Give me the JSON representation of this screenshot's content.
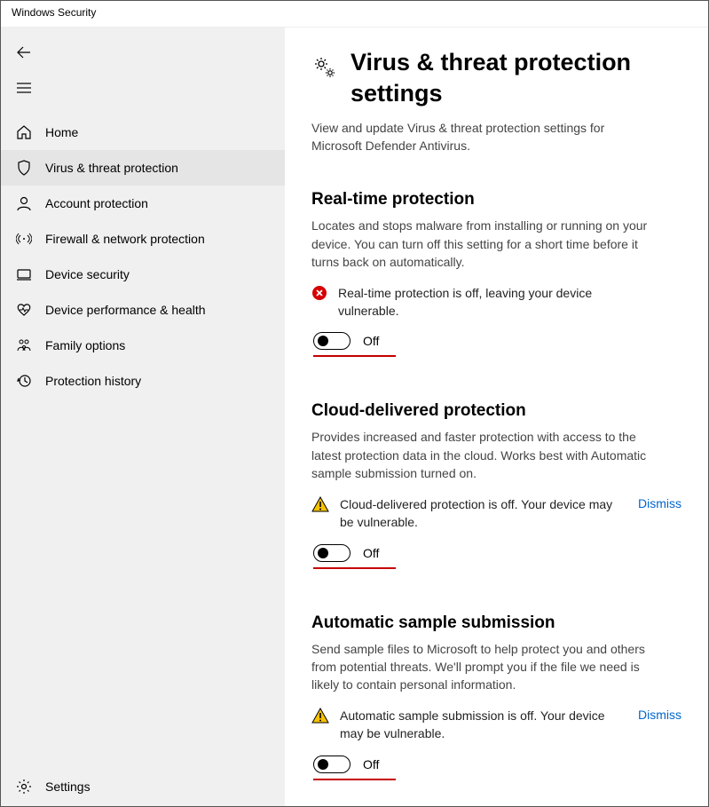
{
  "window": {
    "title": "Windows Security"
  },
  "sidebar": {
    "items": [
      {
        "label": "Home"
      },
      {
        "label": "Virus & threat protection"
      },
      {
        "label": "Account protection"
      },
      {
        "label": "Firewall & network protection"
      },
      {
        "label": "Device security"
      },
      {
        "label": "Device performance & health"
      },
      {
        "label": "Family options"
      },
      {
        "label": "Protection history"
      }
    ],
    "settings_label": "Settings"
  },
  "page": {
    "title": "Virus & threat protection settings",
    "subtitle": "View and update Virus & threat protection settings for Microsoft Defender Antivirus."
  },
  "sections": {
    "realtime": {
      "title": "Real-time protection",
      "desc": "Locates and stops malware from installing or running on your device. You can turn off this setting for a short time before it turns back on automatically.",
      "alert": "Real-time protection is off, leaving your device vulnerable.",
      "toggle_state": "Off"
    },
    "cloud": {
      "title": "Cloud-delivered protection",
      "desc": "Provides increased and faster protection with access to the latest protection data in the cloud. Works best with Automatic sample submission turned on.",
      "alert": "Cloud-delivered protection is off. Your device may be vulnerable.",
      "dismiss": "Dismiss",
      "toggle_state": "Off"
    },
    "sample": {
      "title": "Automatic sample submission",
      "desc": "Send sample files to Microsoft to help protect you and others from potential threats. We'll prompt you if the file we need is likely to contain personal information.",
      "alert": "Automatic sample submission is off. Your device may be vulnerable.",
      "dismiss": "Dismiss",
      "toggle_state": "Off"
    }
  }
}
